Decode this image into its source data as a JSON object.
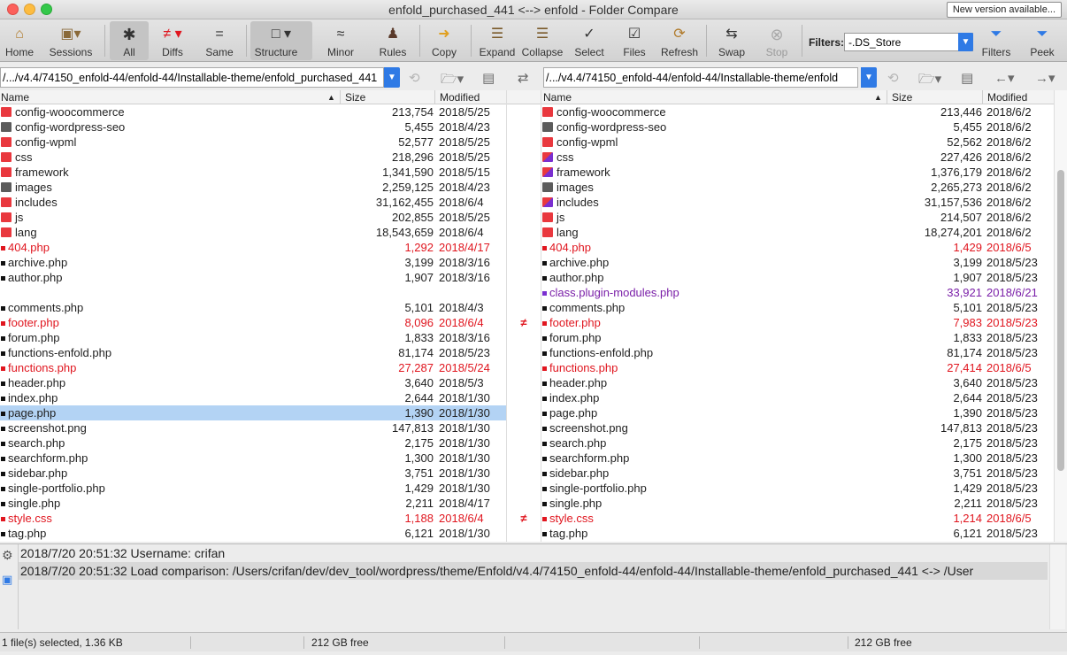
{
  "window": {
    "title": "enfold_purchased_441 <--> enfold - Folder Compare",
    "new_version": "New version available..."
  },
  "toolbar": {
    "home": "Home",
    "sessions": "Sessions",
    "all": "All",
    "diffs": "Diffs",
    "same": "Same",
    "structure": "Structure",
    "minor": "Minor",
    "rules": "Rules",
    "copy": "Copy",
    "expand": "Expand",
    "collapse": "Collapse",
    "select": "Select",
    "files": "Files",
    "refresh": "Refresh",
    "swap": "Swap",
    "stop": "Stop",
    "filters_label": "Filters:",
    "filters_value": "-.DS_Store",
    "filters_btn": "Filters",
    "peek": "Peek"
  },
  "left": {
    "path": "/.../v4.4/74150_enfold-44/enfold-44/Installable-theme/enfold_purchased_441",
    "headers": {
      "name": "Name",
      "size": "Size",
      "modified": "Modified"
    },
    "rows": [
      {
        "type": "folder",
        "color": "red",
        "name": "config-woocommerce",
        "size": "213,754",
        "modified": "2018/5/25"
      },
      {
        "type": "folder",
        "color": "gray",
        "name": "config-wordpress-seo",
        "size": "5,455",
        "modified": "2018/4/23"
      },
      {
        "type": "folder",
        "color": "red",
        "name": "config-wpml",
        "size": "52,577",
        "modified": "2018/5/25"
      },
      {
        "type": "folder",
        "color": "red",
        "name": "css",
        "size": "218,296",
        "modified": "2018/5/25"
      },
      {
        "type": "folder",
        "color": "red",
        "name": "framework",
        "size": "1,341,590",
        "modified": "2018/5/15"
      },
      {
        "type": "folder",
        "color": "gray",
        "name": "images",
        "size": "2,259,125",
        "modified": "2018/4/23"
      },
      {
        "type": "folder",
        "color": "red",
        "name": "includes",
        "size": "31,162,455",
        "modified": "2018/6/4"
      },
      {
        "type": "folder",
        "color": "red",
        "name": "js",
        "size": "202,855",
        "modified": "2018/5/25"
      },
      {
        "type": "folder",
        "color": "red",
        "name": "lang",
        "size": "18,543,659",
        "modified": "2018/6/4"
      },
      {
        "type": "file",
        "state": "diff",
        "name": "404.php",
        "size": "1,292",
        "modified": "2018/4/17"
      },
      {
        "type": "file",
        "state": "same",
        "name": "archive.php",
        "size": "3,199",
        "modified": "2018/3/16"
      },
      {
        "type": "file",
        "state": "same",
        "name": "author.php",
        "size": "1,907",
        "modified": "2018/3/16"
      },
      {
        "type": "empty",
        "name": "",
        "size": "",
        "modified": ""
      },
      {
        "type": "file",
        "state": "same",
        "name": "comments.php",
        "size": "5,101",
        "modified": "2018/4/3"
      },
      {
        "type": "file",
        "state": "diff",
        "name": "footer.php",
        "size": "8,096",
        "modified": "2018/6/4"
      },
      {
        "type": "file",
        "state": "same",
        "name": "forum.php",
        "size": "1,833",
        "modified": "2018/3/16"
      },
      {
        "type": "file",
        "state": "same",
        "name": "functions-enfold.php",
        "size": "81,174",
        "modified": "2018/5/23"
      },
      {
        "type": "file",
        "state": "diff",
        "name": "functions.php",
        "size": "27,287",
        "modified": "2018/5/24"
      },
      {
        "type": "file",
        "state": "same",
        "name": "header.php",
        "size": "3,640",
        "modified": "2018/5/3"
      },
      {
        "type": "file",
        "state": "same",
        "name": "index.php",
        "size": "2,644",
        "modified": "2018/1/30"
      },
      {
        "type": "file",
        "state": "same",
        "selected": true,
        "name": "page.php",
        "size": "1,390",
        "modified": "2018/1/30"
      },
      {
        "type": "file",
        "state": "same",
        "name": "screenshot.png",
        "size": "147,813",
        "modified": "2018/1/30"
      },
      {
        "type": "file",
        "state": "same",
        "name": "search.php",
        "size": "2,175",
        "modified": "2018/1/30"
      },
      {
        "type": "file",
        "state": "same",
        "name": "searchform.php",
        "size": "1,300",
        "modified": "2018/1/30"
      },
      {
        "type": "file",
        "state": "same",
        "name": "sidebar.php",
        "size": "3,751",
        "modified": "2018/1/30"
      },
      {
        "type": "file",
        "state": "same",
        "name": "single-portfolio.php",
        "size": "1,429",
        "modified": "2018/1/30"
      },
      {
        "type": "file",
        "state": "same",
        "name": "single.php",
        "size": "2,211",
        "modified": "2018/4/17"
      },
      {
        "type": "file",
        "state": "diff",
        "name": "style.css",
        "size": "1,188",
        "modified": "2018/6/4"
      },
      {
        "type": "file",
        "state": "same",
        "name": "tag.php",
        "size": "6,121",
        "modified": "2018/1/30"
      }
    ]
  },
  "right": {
    "path": "/.../v4.4/74150_enfold-44/enfold-44/Installable-theme/enfold",
    "headers": {
      "name": "Name",
      "size": "Size",
      "modified": "Modified"
    },
    "rows": [
      {
        "type": "folder",
        "color": "red",
        "name": "config-woocommerce",
        "size": "213,446",
        "modified": "2018/6/2"
      },
      {
        "type": "folder",
        "color": "gray",
        "name": "config-wordpress-seo",
        "size": "5,455",
        "modified": "2018/6/2"
      },
      {
        "type": "folder",
        "color": "red",
        "name": "config-wpml",
        "size": "52,562",
        "modified": "2018/6/2"
      },
      {
        "type": "folder",
        "color": "purple",
        "name": "css",
        "size": "227,426",
        "modified": "2018/6/2"
      },
      {
        "type": "folder",
        "color": "purple",
        "name": "framework",
        "size": "1,376,179",
        "modified": "2018/6/2"
      },
      {
        "type": "folder",
        "color": "gray",
        "name": "images",
        "size": "2,265,273",
        "modified": "2018/6/2"
      },
      {
        "type": "folder",
        "color": "purple",
        "name": "includes",
        "size": "31,157,536",
        "modified": "2018/6/2"
      },
      {
        "type": "folder",
        "color": "red",
        "name": "js",
        "size": "214,507",
        "modified": "2018/6/2"
      },
      {
        "type": "folder",
        "color": "red",
        "name": "lang",
        "size": "18,274,201",
        "modified": "2018/6/2"
      },
      {
        "type": "file",
        "state": "diff",
        "name": "404.php",
        "size": "1,429",
        "modified": "2018/6/5"
      },
      {
        "type": "file",
        "state": "same",
        "name": "archive.php",
        "size": "3,199",
        "modified": "2018/5/23"
      },
      {
        "type": "file",
        "state": "same",
        "name": "author.php",
        "size": "1,907",
        "modified": "2018/5/23"
      },
      {
        "type": "file",
        "state": "orphan",
        "name": "class.plugin-modules.php",
        "size": "33,921",
        "modified": "2018/6/21"
      },
      {
        "type": "file",
        "state": "same",
        "name": "comments.php",
        "size": "5,101",
        "modified": "2018/5/23"
      },
      {
        "type": "file",
        "state": "diff",
        "name": "footer.php",
        "size": "7,983",
        "modified": "2018/5/23"
      },
      {
        "type": "file",
        "state": "same",
        "name": "forum.php",
        "size": "1,833",
        "modified": "2018/5/23"
      },
      {
        "type": "file",
        "state": "same",
        "name": "functions-enfold.php",
        "size": "81,174",
        "modified": "2018/5/23"
      },
      {
        "type": "file",
        "state": "diff",
        "name": "functions.php",
        "size": "27,414",
        "modified": "2018/6/5"
      },
      {
        "type": "file",
        "state": "same",
        "name": "header.php",
        "size": "3,640",
        "modified": "2018/5/23"
      },
      {
        "type": "file",
        "state": "same",
        "name": "index.php",
        "size": "2,644",
        "modified": "2018/5/23"
      },
      {
        "type": "file",
        "state": "same",
        "name": "page.php",
        "size": "1,390",
        "modified": "2018/5/23"
      },
      {
        "type": "file",
        "state": "same",
        "name": "screenshot.png",
        "size": "147,813",
        "modified": "2018/5/23"
      },
      {
        "type": "file",
        "state": "same",
        "name": "search.php",
        "size": "2,175",
        "modified": "2018/5/23"
      },
      {
        "type": "file",
        "state": "same",
        "name": "searchform.php",
        "size": "1,300",
        "modified": "2018/5/23"
      },
      {
        "type": "file",
        "state": "same",
        "name": "sidebar.php",
        "size": "3,751",
        "modified": "2018/5/23"
      },
      {
        "type": "file",
        "state": "same",
        "name": "single-portfolio.php",
        "size": "1,429",
        "modified": "2018/5/23"
      },
      {
        "type": "file",
        "state": "same",
        "name": "single.php",
        "size": "2,211",
        "modified": "2018/5/23"
      },
      {
        "type": "file",
        "state": "diff",
        "name": "style.css",
        "size": "1,214",
        "modified": "2018/6/5"
      },
      {
        "type": "file",
        "state": "same",
        "name": "tag.php",
        "size": "6,121",
        "modified": "2018/5/23"
      }
    ]
  },
  "gutter_marks": [
    "",
    "",
    "",
    "",
    "",
    "",
    "",
    "",
    "",
    "",
    "",
    "",
    "",
    "",
    "≠",
    "",
    "",
    "",
    "",
    "",
    "",
    "",
    "",
    "",
    "",
    "",
    "",
    "≠",
    ""
  ],
  "log": [
    "2018/7/20 20:51:32  Username: crifan",
    "2018/7/20 20:51:32  Load comparison: /Users/crifan/dev/dev_tool/wordpress/theme/Enfold/v4.4/74150_enfold-44/enfold-44/Installable-theme/enfold_purchased_441 <-> /User"
  ],
  "status": {
    "selection": "1 file(s) selected, 1.36 KB",
    "left_free": "212 GB free",
    "right_free": "212 GB free"
  },
  "colors": {
    "accent": "#2f7ae5",
    "diff": "#e0161f",
    "orphan": "#7a1fa8",
    "selection": "#b3d3f4"
  }
}
